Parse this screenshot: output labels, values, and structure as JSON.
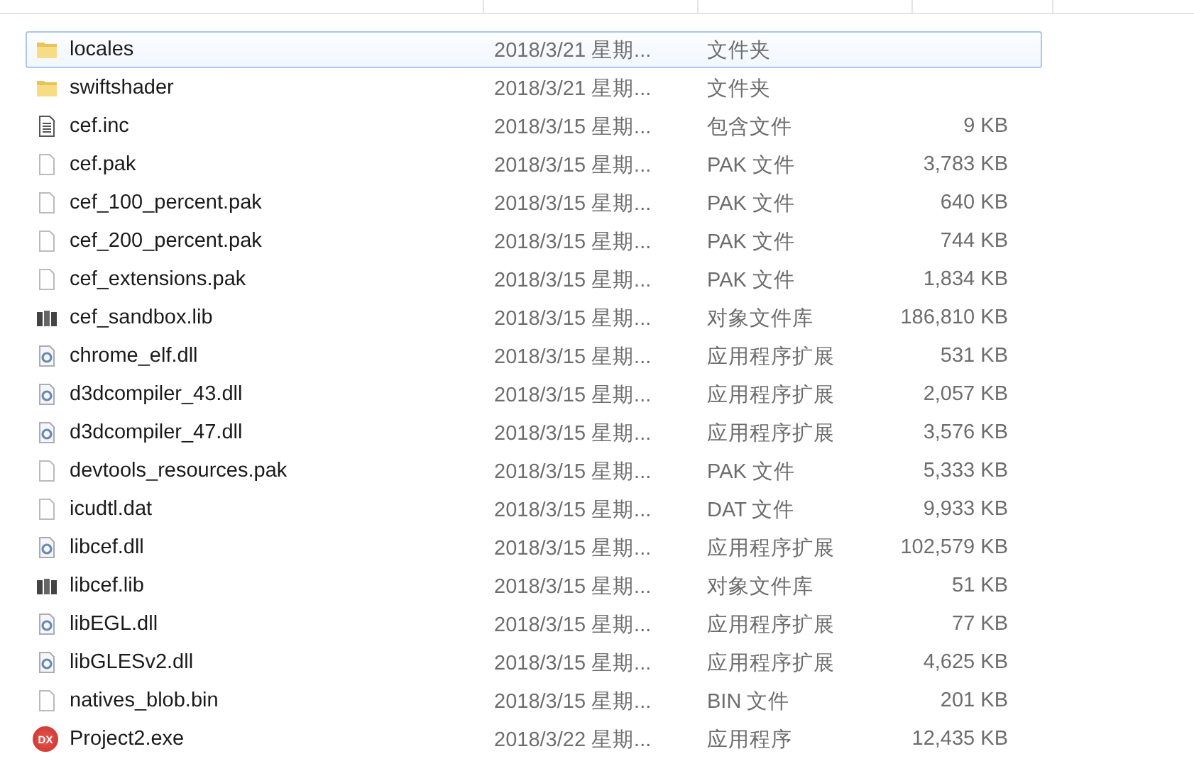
{
  "files": [
    {
      "name": "locales",
      "modified": "2018/3/21 星期...",
      "type": "文件夹",
      "kind": "folder",
      "selected": true
    },
    {
      "name": "swiftshader",
      "modified": "2018/3/21 星期...",
      "type": "文件夹",
      "kind": "folder",
      "selected": false
    },
    {
      "name": "cef.inc",
      "modified": "2018/3/15 星期...",
      "type": "包含文件",
      "size": "9 KB",
      "kind": "text",
      "selected": false
    },
    {
      "name": "cef.pak",
      "modified": "2018/3/15 星期...",
      "type": "PAK 文件",
      "size": "3,783 KB",
      "kind": "blank",
      "selected": false
    },
    {
      "name": "cef_100_percent.pak",
      "modified": "2018/3/15 星期...",
      "type": "PAK 文件",
      "size": "640 KB",
      "kind": "blank",
      "selected": false
    },
    {
      "name": "cef_200_percent.pak",
      "modified": "2018/3/15 星期...",
      "type": "PAK 文件",
      "size": "744 KB",
      "kind": "blank",
      "selected": false
    },
    {
      "name": "cef_extensions.pak",
      "modified": "2018/3/15 星期...",
      "type": "PAK 文件",
      "size": "1,834 KB",
      "kind": "blank",
      "selected": false
    },
    {
      "name": "cef_sandbox.lib",
      "modified": "2018/3/15 星期...",
      "type": "对象文件库",
      "size": "186,810 KB",
      "kind": "lib",
      "selected": false
    },
    {
      "name": "chrome_elf.dll",
      "modified": "2018/3/15 星期...",
      "type": "应用程序扩展",
      "size": "531 KB",
      "kind": "dll",
      "selected": false
    },
    {
      "name": "d3dcompiler_43.dll",
      "modified": "2018/3/15 星期...",
      "type": "应用程序扩展",
      "size": "2,057 KB",
      "kind": "dll",
      "selected": false
    },
    {
      "name": "d3dcompiler_47.dll",
      "modified": "2018/3/15 星期...",
      "type": "应用程序扩展",
      "size": "3,576 KB",
      "kind": "dll",
      "selected": false
    },
    {
      "name": "devtools_resources.pak",
      "modified": "2018/3/15 星期...",
      "type": "PAK 文件",
      "size": "5,333 KB",
      "kind": "blank",
      "selected": false
    },
    {
      "name": "icudtl.dat",
      "modified": "2018/3/15 星期...",
      "type": "DAT 文件",
      "size": "9,933 KB",
      "kind": "blank",
      "selected": false
    },
    {
      "name": "libcef.dll",
      "modified": "2018/3/15 星期...",
      "type": "应用程序扩展",
      "size": "102,579 KB",
      "kind": "dll",
      "selected": false
    },
    {
      "name": "libcef.lib",
      "modified": "2018/3/15 星期...",
      "type": "对象文件库",
      "size": "51 KB",
      "kind": "lib",
      "selected": false
    },
    {
      "name": "libEGL.dll",
      "modified": "2018/3/15 星期...",
      "type": "应用程序扩展",
      "size": "77 KB",
      "kind": "dll",
      "selected": false
    },
    {
      "name": "libGLESv2.dll",
      "modified": "2018/3/15 星期...",
      "type": "应用程序扩展",
      "size": "4,625 KB",
      "kind": "dll",
      "selected": false
    },
    {
      "name": "natives_blob.bin",
      "modified": "2018/3/15 星期...",
      "type": "BIN 文件",
      "size": "201 KB",
      "kind": "blank",
      "selected": false
    },
    {
      "name": "Project2.exe",
      "modified": "2018/3/22 星期...",
      "type": "应用程序",
      "size": "12,435 KB",
      "kind": "exe",
      "logo_text": "DX",
      "selected": false
    }
  ]
}
